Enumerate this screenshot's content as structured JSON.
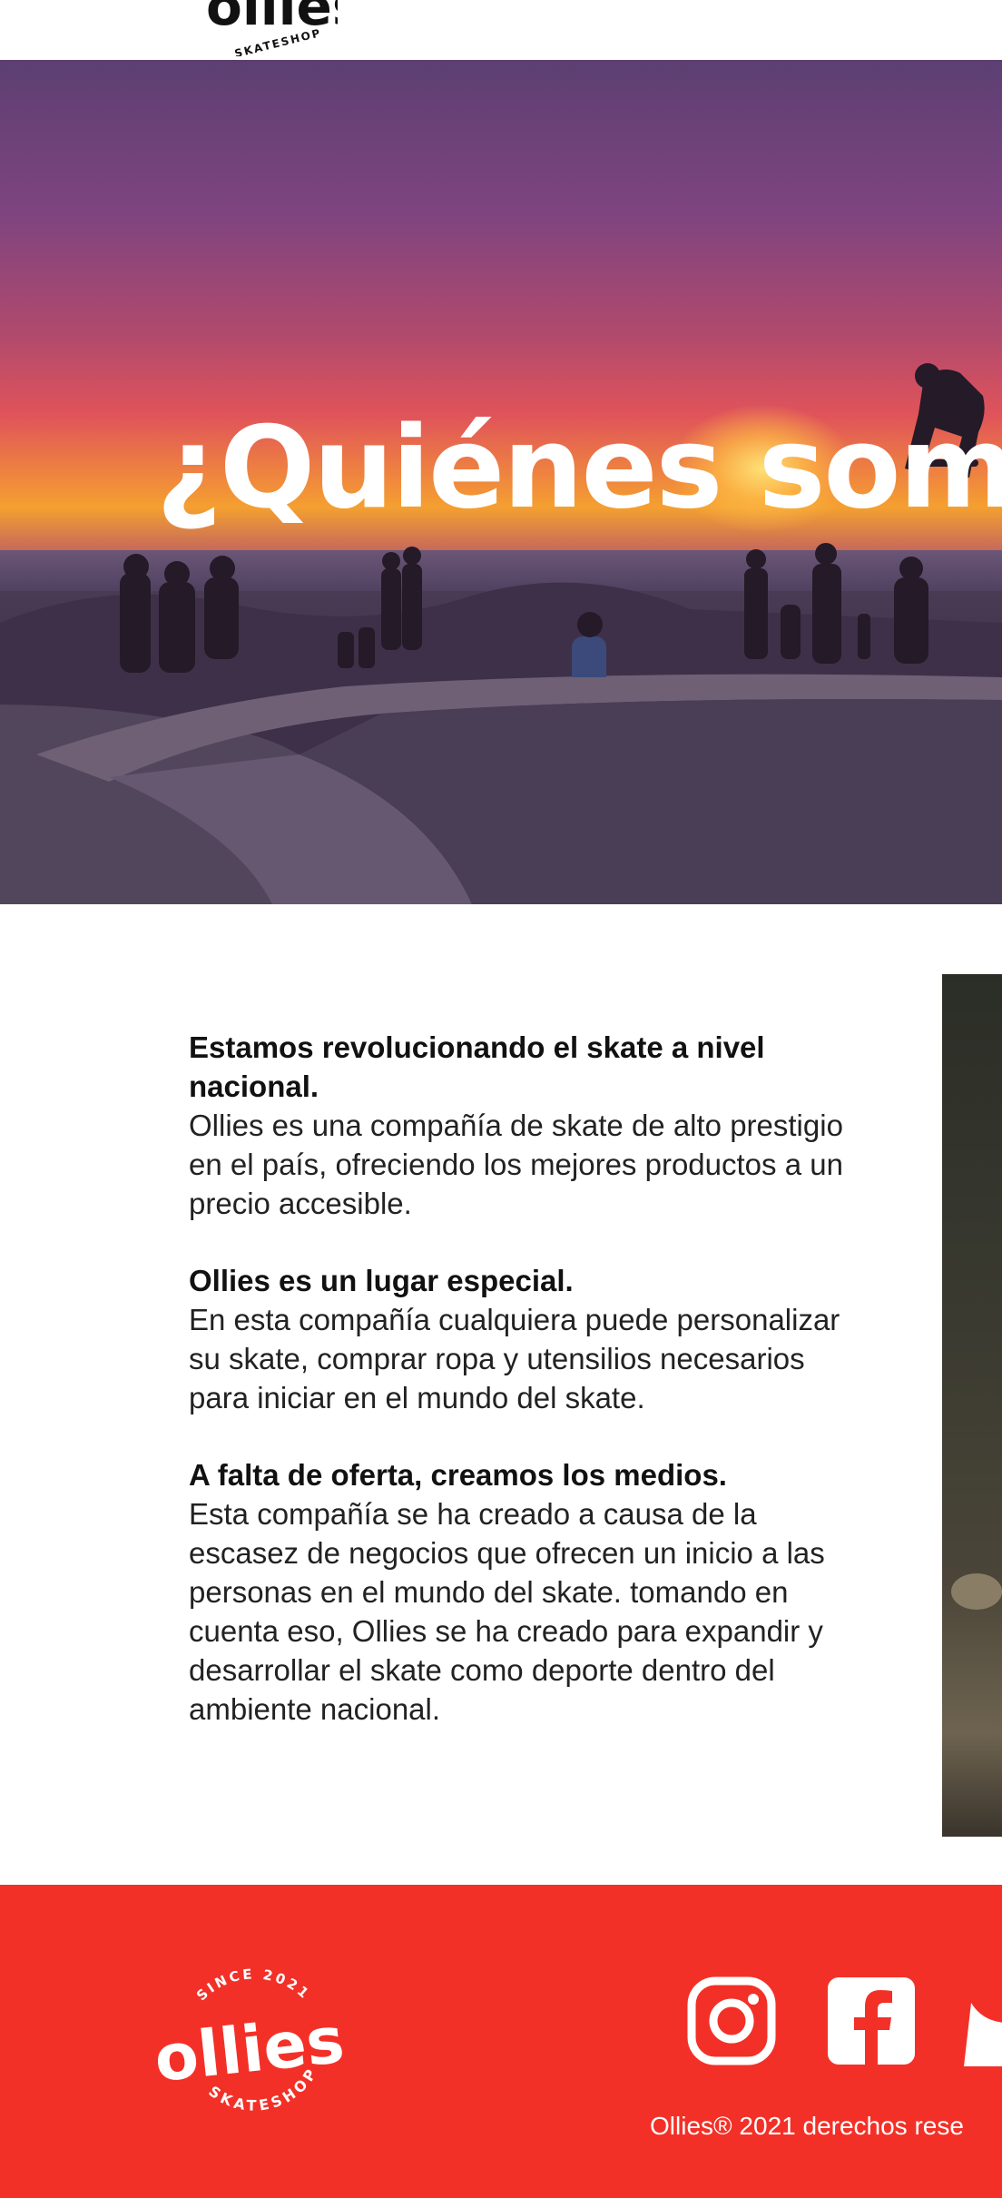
{
  "header": {
    "logo_text": "ollies",
    "logo_subtext": "SKATESHOP"
  },
  "hero": {
    "title": "¿Quiénes somos?"
  },
  "content": {
    "blocks": [
      {
        "title": "Estamos revolucionando el skate a nivel nacional.",
        "text": "Ollies es una compañía de skate de alto prestigio en el país, ofreciendo los mejores productos a un precio accesible."
      },
      {
        "title": "Ollies es un lugar especial.",
        "text": "En esta compañía cualquiera puede personalizar su skate, comprar ropa y utensilios necesarios para iniciar en el mundo del skate."
      },
      {
        "title": "A falta de oferta, creamos los medios.",
        "text": "Esta compañía se ha creado a causa de la escasez de negocios que ofrecen un inicio a las personas en el mundo del skate. tomando en cuenta eso, Ollies se ha creado para expandir y desarrollar el skate como deporte dentro del ambiente nacional."
      }
    ]
  },
  "footer": {
    "logo_since": "SINCE 2021",
    "logo_text": "ollies",
    "logo_subtext": "SKATESHOP",
    "social": [
      "instagram-icon",
      "facebook-icon",
      "twitter-icon"
    ],
    "copyright": "Ollies® 2021 derechos rese"
  },
  "colors": {
    "footer_bg": "#f33027",
    "text": "#111111",
    "hero_title": "#ffffff"
  }
}
